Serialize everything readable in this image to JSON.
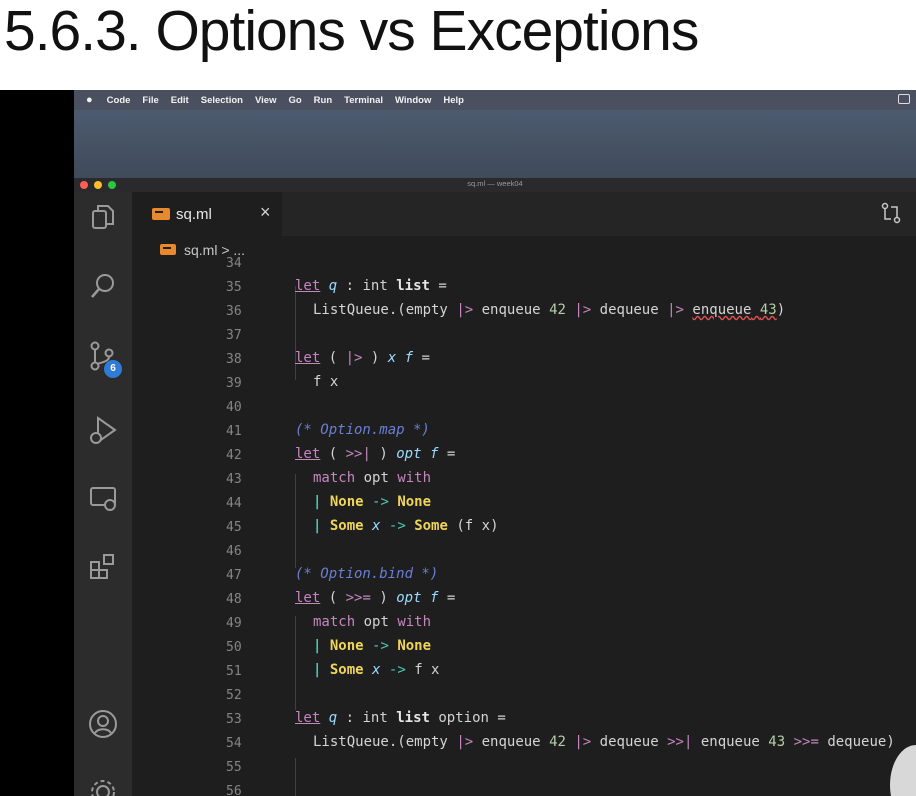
{
  "page_title": "5.6.3. Options vs Exceptions",
  "menubar": [
    "Code",
    "File",
    "Edit",
    "Selection",
    "View",
    "Go",
    "Run",
    "Terminal",
    "Window",
    "Help"
  ],
  "window_title": "sq.ml — week04",
  "traffic_colors": [
    "#ff5f57",
    "#febc2e",
    "#28c840"
  ],
  "activity_icons": [
    "explorer-icon",
    "search-icon",
    "source-control-icon",
    "run-debug-icon",
    "remote-explorer-icon",
    "extensions-icon",
    "account-icon",
    "settings-gear-icon"
  ],
  "scm_badge": "6",
  "tab": {
    "label": "sq.ml",
    "close": "×"
  },
  "breadcrumb": "sq.ml > ...",
  "line_numbers": [
    "34",
    "35",
    "36",
    "37",
    "38",
    "39",
    "40",
    "41",
    "42",
    "43",
    "44",
    "45",
    "46",
    "47",
    "48",
    "49",
    "50",
    "51",
    "52",
    "53",
    "54",
    "55",
    "56"
  ],
  "code": {
    "l34": "",
    "l35": "let q : int list =",
    "l36": "ListQueue.(empty |> enqueue 42 |> dequeue |> enqueue 43)",
    "l37": "",
    "l38": "let ( |> ) x f =",
    "l39": "f x",
    "l40": "",
    "l41": "(* Option.map *)",
    "l42": "let ( >>| ) opt f =",
    "l43": "match opt with",
    "l44": "| None -> None",
    "l45": "| Some x -> Some (f x)",
    "l46": "",
    "l47": "(* Option.bind *)",
    "l48": "let ( >>= ) opt f =",
    "l49": "match opt with",
    "l50": "| None -> None",
    "l51": "| Some x -> f x",
    "l52": "",
    "l53": "let q : int list option =",
    "l54": "ListQueue.(empty |> enqueue 42 |> dequeue >>| enqueue 43 >>= dequeue)",
    "l55": "",
    "l56": ""
  },
  "tokens": {
    "let": "let",
    "q": "q",
    "colon": ":",
    "int": "int",
    "list": "list",
    "eq": "=",
    "option": "option",
    "lq": "ListQueue.(",
    "empty": "empty",
    "pipe": "|>",
    "enqueue": "enqueue",
    "dequeue": "dequeue",
    "n42": "42",
    "n43": "43",
    "close": ")",
    "lparen": "(",
    "rparen": ")",
    "x": "x",
    "f": "f",
    "fx": "f x",
    "cmt_map": "(* Option.map *)",
    "cmt_bind": "(* Option.bind *)",
    "map_op": ">>|",
    "bind_op": ">>=",
    "opt": "opt",
    "match": "match",
    "with": "with",
    "bar": "|",
    "None": "None",
    "Some": "Some",
    "arrow": "->",
    "fx_paren": "(f x)"
  },
  "colors": {
    "keyword": "#c586c0",
    "variable": "#9cdcfe",
    "comment": "#6a7fd6",
    "constructor": "#f0d55a",
    "operator_pipe": "#4ec9b0",
    "badge": "#2f7bd6"
  }
}
